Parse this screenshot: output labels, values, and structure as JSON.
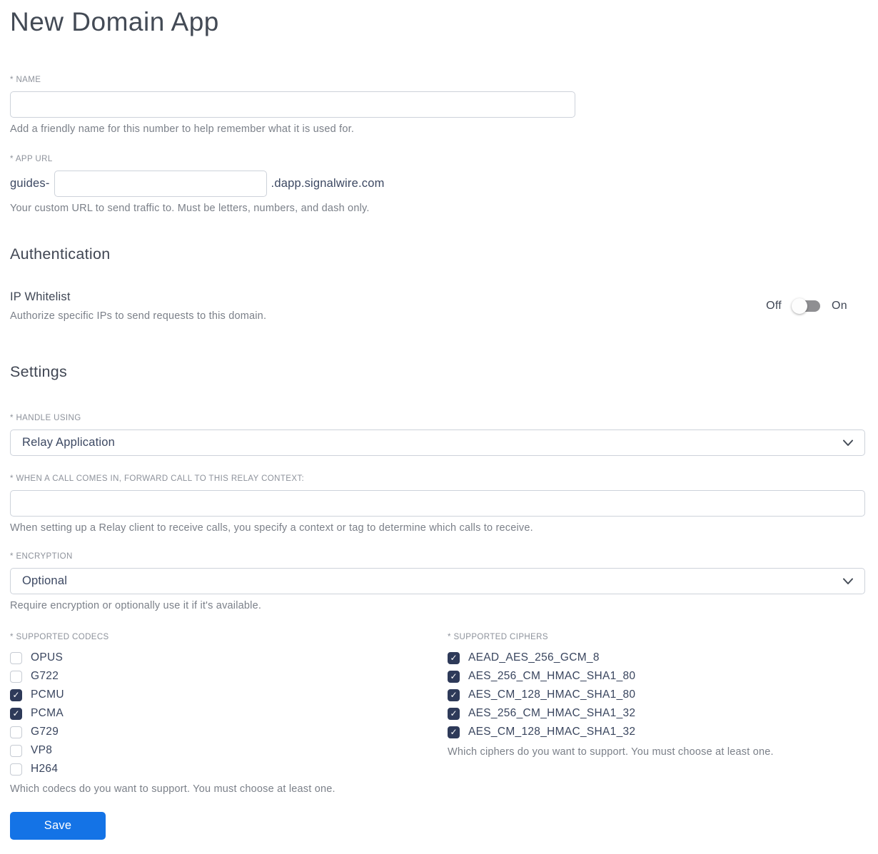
{
  "page": {
    "title": "New Domain App"
  },
  "name_field": {
    "label": "* NAME",
    "value": "",
    "helper": "Add a friendly name for this number to help remember what it is used for."
  },
  "app_url": {
    "label": "* APP URL",
    "prefix": "guides-",
    "value": "",
    "suffix": ".dapp.signalwire.com",
    "helper": "Your custom URL to send traffic to. Must be letters, numbers, and dash only."
  },
  "authentication": {
    "heading": "Authentication",
    "ip_whitelist": {
      "label": "IP Whitelist",
      "helper": "Authorize specific IPs to send requests to this domain.",
      "off_label": "Off",
      "on_label": "On",
      "state": "off"
    }
  },
  "settings": {
    "heading": "Settings",
    "handle_using": {
      "label": "* HANDLE USING",
      "value": "Relay Application"
    },
    "relay_context": {
      "label": "* WHEN A CALL COMES IN, FORWARD CALL TO THIS RELAY CONTEXT:",
      "value": "",
      "helper": "When setting up a Relay client to receive calls, you specify a context or tag to determine which calls to receive."
    },
    "encryption": {
      "label": "* ENCRYPTION",
      "value": "Optional",
      "helper": "Require encryption or optionally use it if it's available."
    },
    "codecs": {
      "label": "* SUPPORTED CODECS",
      "helper": "Which codecs do you want to support. You must choose at least one.",
      "options": [
        {
          "label": "OPUS",
          "checked": false
        },
        {
          "label": "G722",
          "checked": false
        },
        {
          "label": "PCMU",
          "checked": true
        },
        {
          "label": "PCMA",
          "checked": true
        },
        {
          "label": "G729",
          "checked": false
        },
        {
          "label": "VP8",
          "checked": false
        },
        {
          "label": "H264",
          "checked": false
        }
      ]
    },
    "ciphers": {
      "label": "* SUPPORTED CIPHERS",
      "helper": "Which ciphers do you want to support. You must choose at least one.",
      "options": [
        {
          "label": "AEAD_AES_256_GCM_8",
          "checked": true
        },
        {
          "label": "AES_256_CM_HMAC_SHA1_80",
          "checked": true
        },
        {
          "label": "AES_CM_128_HMAC_SHA1_80",
          "checked": true
        },
        {
          "label": "AES_256_CM_HMAC_SHA1_32",
          "checked": true
        },
        {
          "label": "AES_CM_128_HMAC_SHA1_32",
          "checked": true
        }
      ]
    }
  },
  "actions": {
    "save_label": "Save"
  },
  "colors": {
    "accent_blue": "#1473e6",
    "checkbox_navy": "#2e3a59",
    "toggle_track_gray": "#8f8f92",
    "border_gray": "#cdd2da"
  },
  "icons": {
    "checkmark": "✓"
  }
}
